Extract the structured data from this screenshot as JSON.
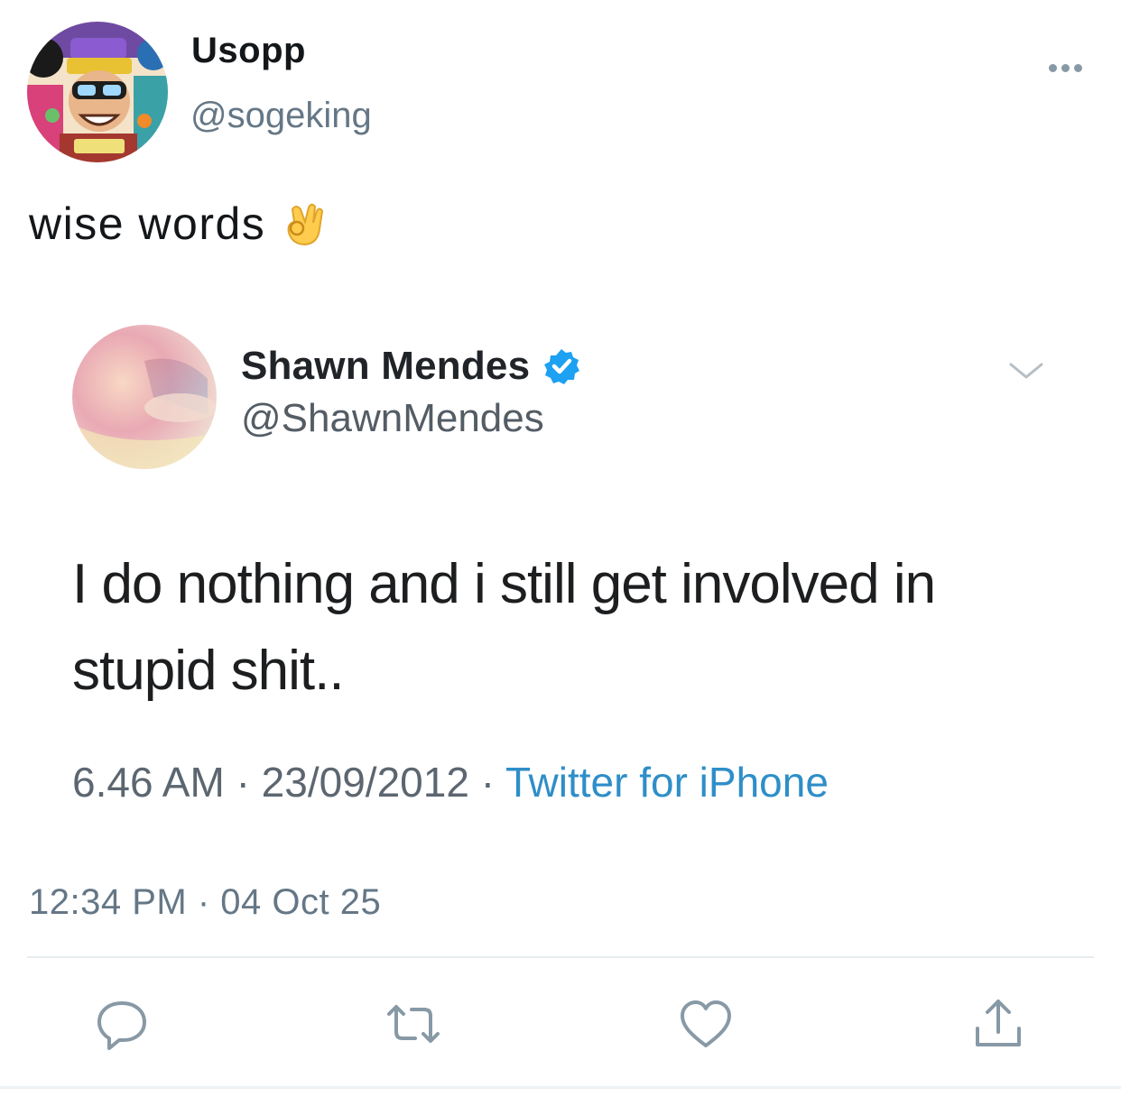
{
  "tweet": {
    "author": {
      "display_name": "Usopp",
      "handle": "@sogeking"
    },
    "text": "wise words",
    "emoji": "ok-hand",
    "timestamp": "12:34 PM · 04 Oct 25"
  },
  "embedded_tweet": {
    "author": {
      "display_name": "Shawn Mendes",
      "handle": "@ShawnMendes",
      "verified": true
    },
    "text": "I do nothing and i still get involved in stupid shit..",
    "time": "6.46 AM",
    "separator": "·",
    "date": "23/09/2012",
    "source": "Twitter for iPhone"
  },
  "actions": [
    "reply-icon",
    "retweet-icon",
    "like-icon",
    "share-icon"
  ],
  "colors": {
    "primary_text": "#14171a",
    "secondary_text": "#657786",
    "icon_gray": "#8899a6",
    "twitter_blue": "#1da1f2",
    "source_blue": "#2e8ec8",
    "divider": "#e6ecf0"
  }
}
